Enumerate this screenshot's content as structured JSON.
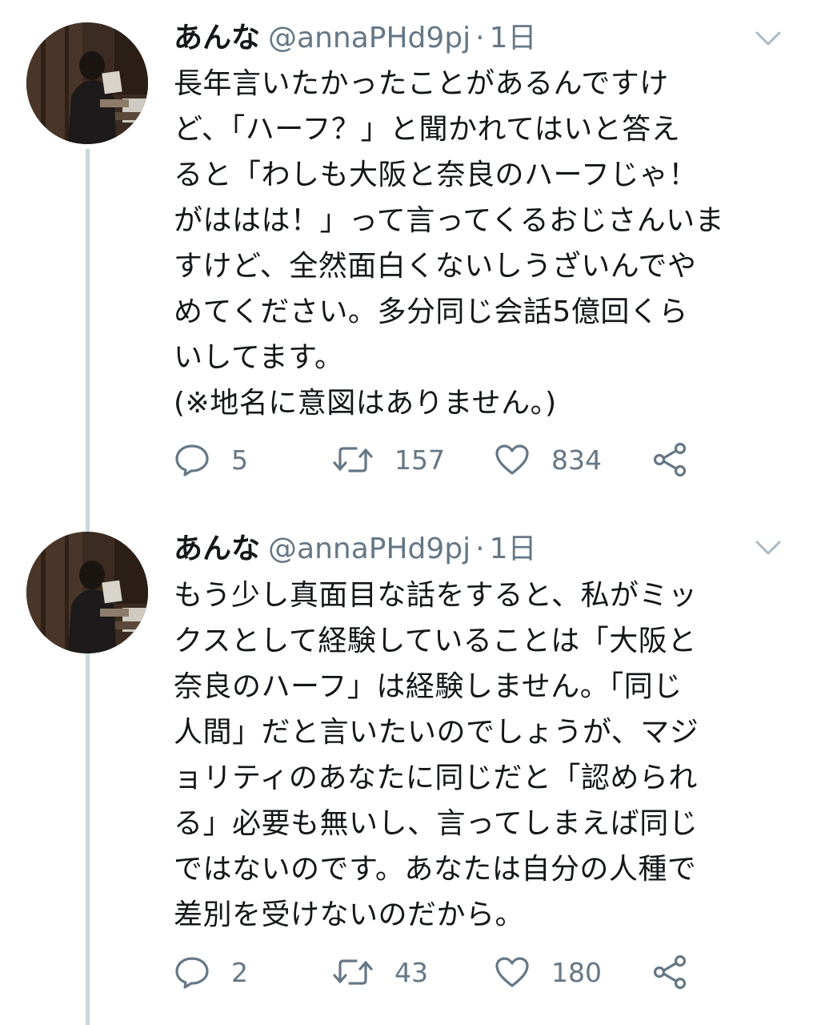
{
  "tweets": [
    {
      "display_name": "あんな",
      "handle": "@annaPHd9pj",
      "separator": "·",
      "time": "1日",
      "text_lines": [
        "長年言いたかったことがあるんですけ",
        "ど、「ハーフ？」と聞かれてはいと答え",
        "ると「わしも大阪と奈良のハーフじゃ！",
        "がははは！」って言ってくるおじさんいま",
        "すけど、全然面白くないしうざいんでや",
        "めてください。多分同じ会話5億回くら",
        "いしてます。",
        "(※地名に意図はありません。)"
      ],
      "replies": "5",
      "retweets": "157",
      "likes": "834"
    },
    {
      "display_name": "あんな",
      "handle": "@annaPHd9pj",
      "separator": "·",
      "time": "1日",
      "text_lines": [
        "もう少し真面目な話をすると、私がミッ",
        "クスとして経験していることは「大阪と",
        "奈良のハーフ」は経験しません。「同じ",
        "人間」だと言いたいのでしょうが、マジ",
        "ョリティのあなたに同じだと「認められ",
        "る」必要も無いし、言ってしまえば同じ",
        "ではないのです。あなたは自分の人種で",
        "差別を受けないのだから。"
      ],
      "replies": "2",
      "retweets": "43",
      "likes": "180"
    }
  ],
  "icons": {
    "reply": "speech-bubble-icon",
    "retweet": "retweet-arrows-icon",
    "like": "heart-icon",
    "share": "share-nodes-icon",
    "caret": "chevron-down-icon"
  },
  "colors": {
    "text": "#14171a",
    "secondary": "#657786",
    "thread_line": "#ccd6dd",
    "background": "#ffffff"
  }
}
